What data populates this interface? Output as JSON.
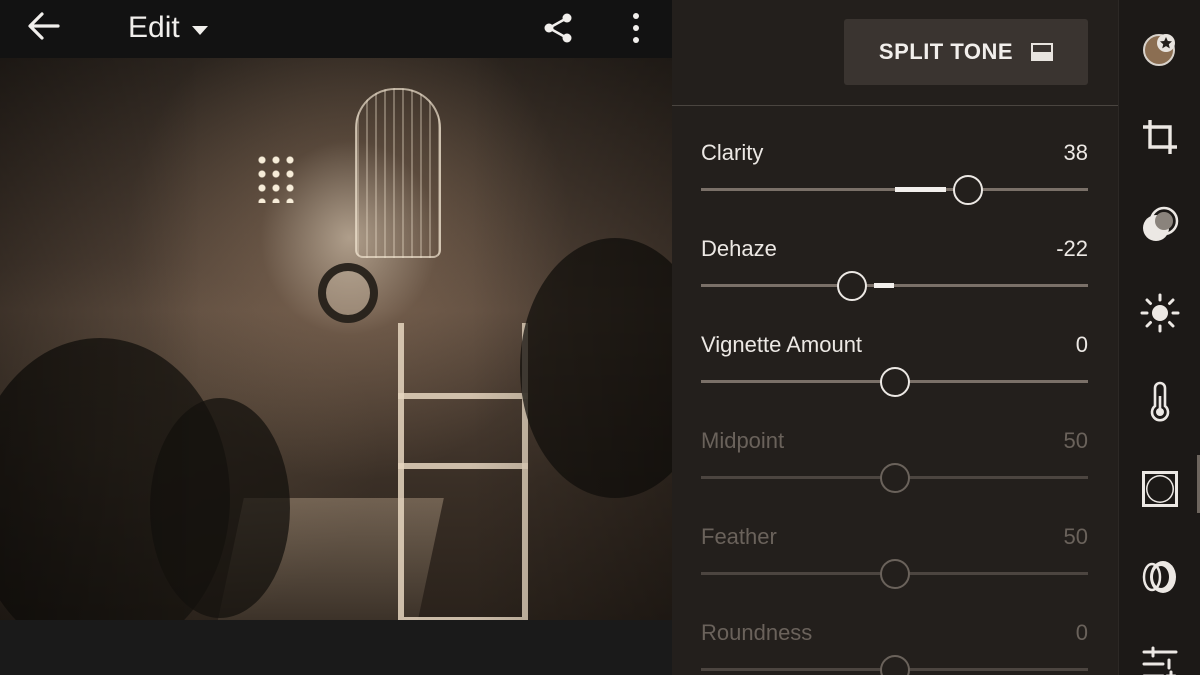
{
  "topbar": {
    "title": "Edit",
    "icons": [
      "back-arrow-icon",
      "chevron-down-icon",
      "share-icon",
      "more-vert-icon"
    ]
  },
  "panel": {
    "header_button": {
      "label": "SPLIT TONE",
      "icon": "split-tone-icon"
    },
    "sliders": [
      {
        "name": "Clarity",
        "value": "38",
        "min": -100,
        "max": 100,
        "num": 38,
        "enabled": true
      },
      {
        "name": "Dehaze",
        "value": "-22",
        "min": -100,
        "max": 100,
        "num": -22,
        "enabled": true
      },
      {
        "name": "Vignette Amount",
        "value": "0",
        "min": -100,
        "max": 100,
        "num": 0,
        "enabled": true
      },
      {
        "name": "Midpoint",
        "value": "50",
        "min": 0,
        "max": 100,
        "num": 50,
        "enabled": false
      },
      {
        "name": "Feather",
        "value": "50",
        "min": 0,
        "max": 100,
        "num": 50,
        "enabled": false
      },
      {
        "name": "Roundness",
        "value": "0",
        "min": -100,
        "max": 100,
        "num": 0,
        "enabled": false
      }
    ]
  },
  "rail": {
    "icons": [
      "presets-icon",
      "crop-icon",
      "selective-icon",
      "light-icon",
      "temperature-icon",
      "effects-icon",
      "optics-icon",
      "adjustments-icon"
    ],
    "active": "effects-icon"
  },
  "colors": {
    "panel_bg": "#231f1c",
    "accent": "#f2efec",
    "disabled_text": "#6a625b"
  }
}
